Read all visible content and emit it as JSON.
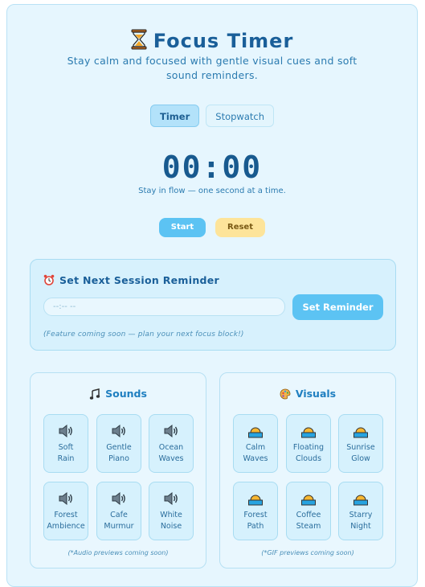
{
  "header": {
    "title": "Focus Timer",
    "subtitle": "Stay calm and focused with gentle visual cues and soft sound reminders."
  },
  "tabs": [
    {
      "label": "Timer",
      "active": true
    },
    {
      "label": "Stopwatch",
      "active": false
    }
  ],
  "timer": {
    "display": "00:00",
    "caption": "Stay in flow — one second at a time.",
    "start_label": "Start",
    "reset_label": "Reset"
  },
  "reminder": {
    "title": "Set Next Session Reminder",
    "input_placeholder": "--:-- --",
    "button_label": "Set Reminder",
    "note": "(Feature coming soon — plan your next focus block!)"
  },
  "sounds": {
    "title": "Sounds",
    "items": [
      {
        "label": "Soft\nRain",
        "icon": "speaker-icon"
      },
      {
        "label": "Gentle\nPiano",
        "icon": "speaker-icon"
      },
      {
        "label": "Ocean\nWaves",
        "icon": "speaker-icon"
      },
      {
        "label": "Forest\nAmbience",
        "icon": "speaker-icon"
      },
      {
        "label": "Cafe\nMurmur",
        "icon": "speaker-icon"
      },
      {
        "label": "White\nNoise",
        "icon": "speaker-icon"
      }
    ],
    "note": "(*Audio previews coming soon)"
  },
  "visuals": {
    "title": "Visuals",
    "items": [
      {
        "label": "Calm\nWaves",
        "icon": "sunset-icon"
      },
      {
        "label": "Floating\nClouds",
        "icon": "sunset-icon"
      },
      {
        "label": "Sunrise\nGlow",
        "icon": "sunset-icon"
      },
      {
        "label": "Forest\nPath",
        "icon": "sunset-icon"
      },
      {
        "label": "Coffee\nSteam",
        "icon": "sunset-icon"
      },
      {
        "label": "Starry\nNight",
        "icon": "sunset-icon"
      }
    ],
    "note": "(*GIF previews coming soon)"
  },
  "colors": {
    "accent": "#5cc3f3",
    "reset": "#fde49a",
    "title": "#1a5f99",
    "card_bg": "#e6f6fe"
  }
}
